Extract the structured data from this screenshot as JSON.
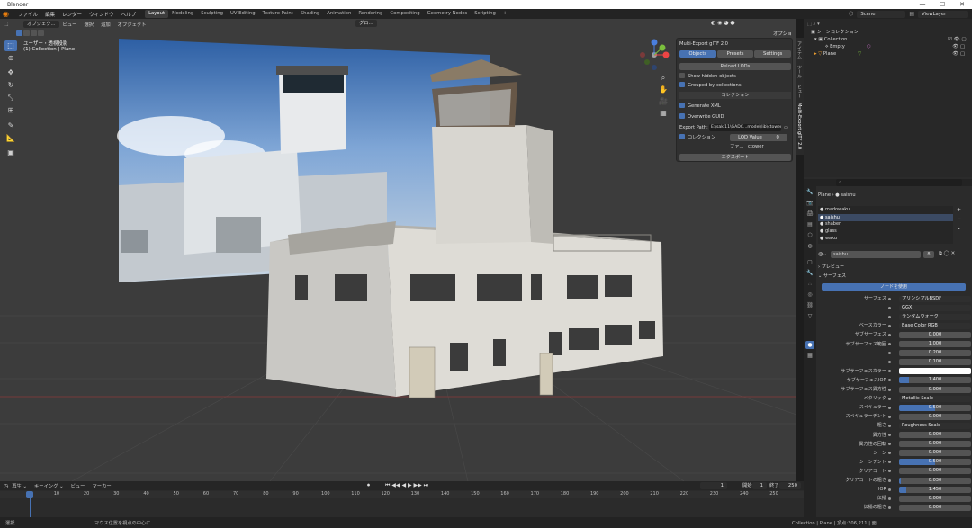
{
  "window": {
    "title": "Blender",
    "buttons": [
      "—",
      "☐",
      "✕"
    ]
  },
  "menubar": {
    "menus": [
      "ファイル",
      "編集",
      "レンダー",
      "ウィンドウ",
      "ヘルプ"
    ],
    "workspaces": [
      "Layout",
      "Modeling",
      "Sculpting",
      "UV Editing",
      "Texture Paint",
      "Shading",
      "Animation",
      "Rendering",
      "Compositing",
      "Geometry Nodes",
      "Scripting",
      "+"
    ],
    "active_workspace": "Layout",
    "scene": "Scene",
    "view_layer": "ViewLayer"
  },
  "viewport": {
    "header_menus": [
      "オブジェク...",
      "ビュー",
      "選択",
      "追加",
      "オブジェクト"
    ],
    "transform_orientation": "グロ...",
    "options_label": "オプション ⌄",
    "view_name": "ユーザー・透視投影",
    "collection_path": "(1) Collection | Plane",
    "tools": [
      "select",
      "cursor",
      "move",
      "rotate",
      "scale",
      "transform",
      "annotate",
      "measure",
      "add-cube"
    ],
    "gizmo": {
      "x": "X",
      "y": "Y",
      "z": "Z"
    }
  },
  "npanel": {
    "title": "Multi-Export glTF 2.0",
    "tabs": [
      "Objects",
      "Presets",
      "Settings"
    ],
    "reload_button": "Reload LODs",
    "show_hidden": "Show hidden objects",
    "grouped": "Grouped by collections",
    "collection_header": "コレクション",
    "generate_xml": "Generate XML",
    "overwrite_guid": "Overwrite GUID",
    "export_path_label": "Export Path:",
    "export_path_value": "E:\\saki11\\GADC...model\\lib\\ctower\\",
    "collection_label": "コレクション",
    "lod_value": "LOD Value",
    "lod_number": "0",
    "file_label": "ファ...",
    "file_value": "ctower",
    "export_button": "エクスポート",
    "side_tabs": [
      "アイテム",
      "ツール",
      "ビュー",
      "Multi-Export glTF 2.0"
    ]
  },
  "outliner": {
    "header": "シーンコレクション",
    "items": [
      {
        "label": "Collection",
        "level": 1
      },
      {
        "label": "Empty",
        "level": 2
      },
      {
        "label": "Plane",
        "level": 1
      }
    ]
  },
  "properties": {
    "object_breadcrumb": [
      "Plane",
      "saishu"
    ],
    "materials": [
      "madowaku",
      "saishu",
      "shaber",
      "glass",
      "waku"
    ],
    "active_material": "saishu",
    "material_name": "saishu",
    "user_count": "8",
    "preview_label": "プレビュー",
    "surface_label": "サーフェス",
    "use_nodes_button": "ノードを使用",
    "rows": [
      {
        "label": "サーフェス",
        "value": "プリンシプルBSDF",
        "kind": "node"
      },
      {
        "label": "",
        "value": "GGX",
        "kind": "enum"
      },
      {
        "label": "",
        "value": "ランダムウォーク",
        "kind": "enum"
      },
      {
        "label": "ベースカラー",
        "value": "Base Color RGB",
        "kind": "node"
      },
      {
        "label": "サブサーフェス",
        "value": "0.000",
        "kind": "num",
        "fill": 0
      },
      {
        "label": "サブサーフェス範囲",
        "value": "1.000",
        "kind": "num",
        "fill": 0
      },
      {
        "label": "",
        "value": "0.200",
        "kind": "num",
        "fill": 0
      },
      {
        "label": "",
        "value": "0.100",
        "kind": "num",
        "fill": 0
      },
      {
        "label": "サブサーフェスカラー",
        "value": "",
        "kind": "color",
        "color": "#ffffff"
      },
      {
        "label": "サブサーフェスIOR",
        "value": "1.400",
        "kind": "num",
        "fill": 0.14
      },
      {
        "label": "サブサーフェス異方性",
        "value": "0.000",
        "kind": "num",
        "fill": 0
      },
      {
        "label": "メタリック",
        "value": "Metallic Scale",
        "kind": "node"
      },
      {
        "label": "スペキュラー",
        "value": "0.500",
        "kind": "num",
        "fill": 0.5
      },
      {
        "label": "スペキュラーチント",
        "value": "0.000",
        "kind": "num",
        "fill": 0
      },
      {
        "label": "粗さ",
        "value": "Roughness Scale",
        "kind": "node"
      },
      {
        "label": "異方性",
        "value": "0.000",
        "kind": "num",
        "fill": 0
      },
      {
        "label": "異方性の回転",
        "value": "0.000",
        "kind": "num",
        "fill": 0
      },
      {
        "label": "シーン",
        "value": "0.000",
        "kind": "num",
        "fill": 0
      },
      {
        "label": "シーンチント",
        "value": "0.500",
        "kind": "num",
        "fill": 0.5
      },
      {
        "label": "クリアコート",
        "value": "0.000",
        "kind": "num",
        "fill": 0
      },
      {
        "label": "クリアコートの粗さ",
        "value": "0.030",
        "kind": "num",
        "fill": 0.03
      },
      {
        "label": "IOR",
        "value": "1.450",
        "kind": "num",
        "fill": 0.1
      },
      {
        "label": "伝播",
        "value": "0.000",
        "kind": "num",
        "fill": 0
      },
      {
        "label": "伝播の粗さ",
        "value": "0.000",
        "kind": "num",
        "fill": 0
      }
    ]
  },
  "timeline": {
    "menus": [
      "再生 ⌄",
      "キーイング ⌄",
      "ビュー",
      "マーカー"
    ],
    "current_frame": "1",
    "start_label": "開始",
    "start_value": "1",
    "end_label": "終了",
    "end_value": "250",
    "ticks": [
      "1",
      "10",
      "20",
      "30",
      "40",
      "50",
      "60",
      "70",
      "80",
      "90",
      "100",
      "110",
      "120",
      "130",
      "140",
      "150",
      "160",
      "170",
      "180",
      "190",
      "200",
      "210",
      "220",
      "230",
      "240",
      "250"
    ]
  },
  "statusbar": {
    "left": "選択",
    "middle": "マウス位置を視点の中心に",
    "right": "Collection | Plane | 頂点:306,211 | 面:"
  }
}
